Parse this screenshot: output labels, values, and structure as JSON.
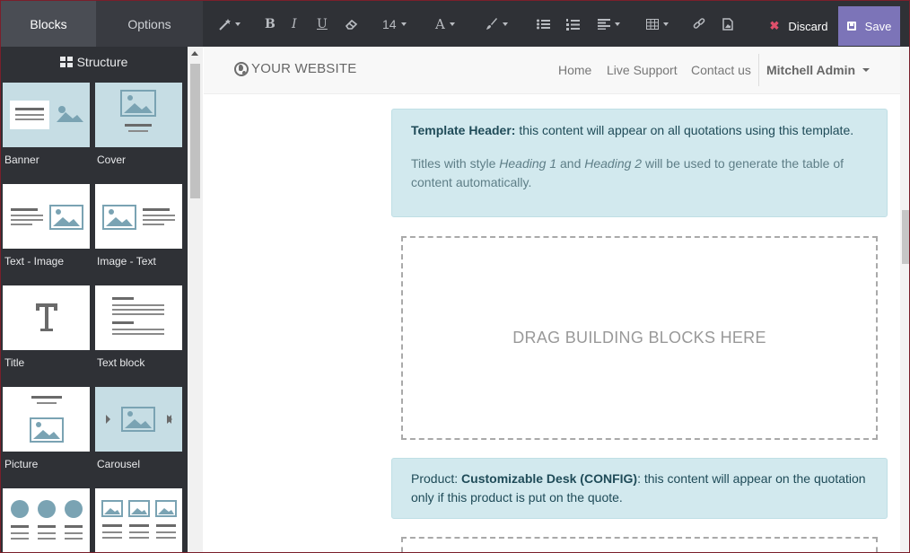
{
  "sidebar": {
    "tabs": [
      {
        "label": "Blocks",
        "active": true
      },
      {
        "label": "Options",
        "active": false
      }
    ],
    "section_title": "Structure",
    "blocks": [
      {
        "label": "Banner",
        "highlighted": true
      },
      {
        "label": "Cover",
        "highlighted": true
      },
      {
        "label": "Text - Image",
        "highlighted": false
      },
      {
        "label": "Image - Text",
        "highlighted": false
      },
      {
        "label": "Title",
        "highlighted": false
      },
      {
        "label": "Text block",
        "highlighted": false
      },
      {
        "label": "Picture",
        "highlighted": false
      },
      {
        "label": "Carousel",
        "highlighted": true
      },
      {
        "label": "",
        "highlighted": false
      },
      {
        "label": "",
        "highlighted": false
      }
    ]
  },
  "toolbar": {
    "font_size": "14",
    "discard_label": "Discard",
    "save_label": "Save",
    "icons": [
      "magic-wand-icon",
      "bold-icon",
      "italic-icon",
      "underline-icon",
      "eraser-icon",
      "font-size-select",
      "font-color-icon",
      "background-color-icon",
      "unordered-list-icon",
      "ordered-list-icon",
      "align-icon",
      "table-icon",
      "link-icon",
      "image-icon"
    ]
  },
  "site_nav": {
    "brand": "YOUR WEBSITE",
    "links": [
      "Home",
      "Live Support",
      "Contact us"
    ],
    "user": "Mitchell Admin"
  },
  "content": {
    "header_alert": {
      "bold": "Template Header:",
      "text": " this content will appear on all quotations using this template.",
      "line2_a": "Titles with style ",
      "line2_em1": "Heading 1",
      "line2_b": " and ",
      "line2_em2": "Heading 2",
      "line2_c": " will be used to generate the table of content automatically."
    },
    "dropzone_text": "DRAG BUILDING BLOCKS HERE",
    "product_alert": {
      "prefix": "Product: ",
      "product": "Customizable Desk (CONFIG)",
      "text": ": this content will appear on the quotation only if this product is put on the quote."
    }
  },
  "colors": {
    "sidebar_bg": "#2f3136",
    "save_bg": "#7c74b8",
    "discard_icon": "#e0506b",
    "alert_bg": "#d2e9ee",
    "highlight_thumb": "#c6dde4"
  }
}
